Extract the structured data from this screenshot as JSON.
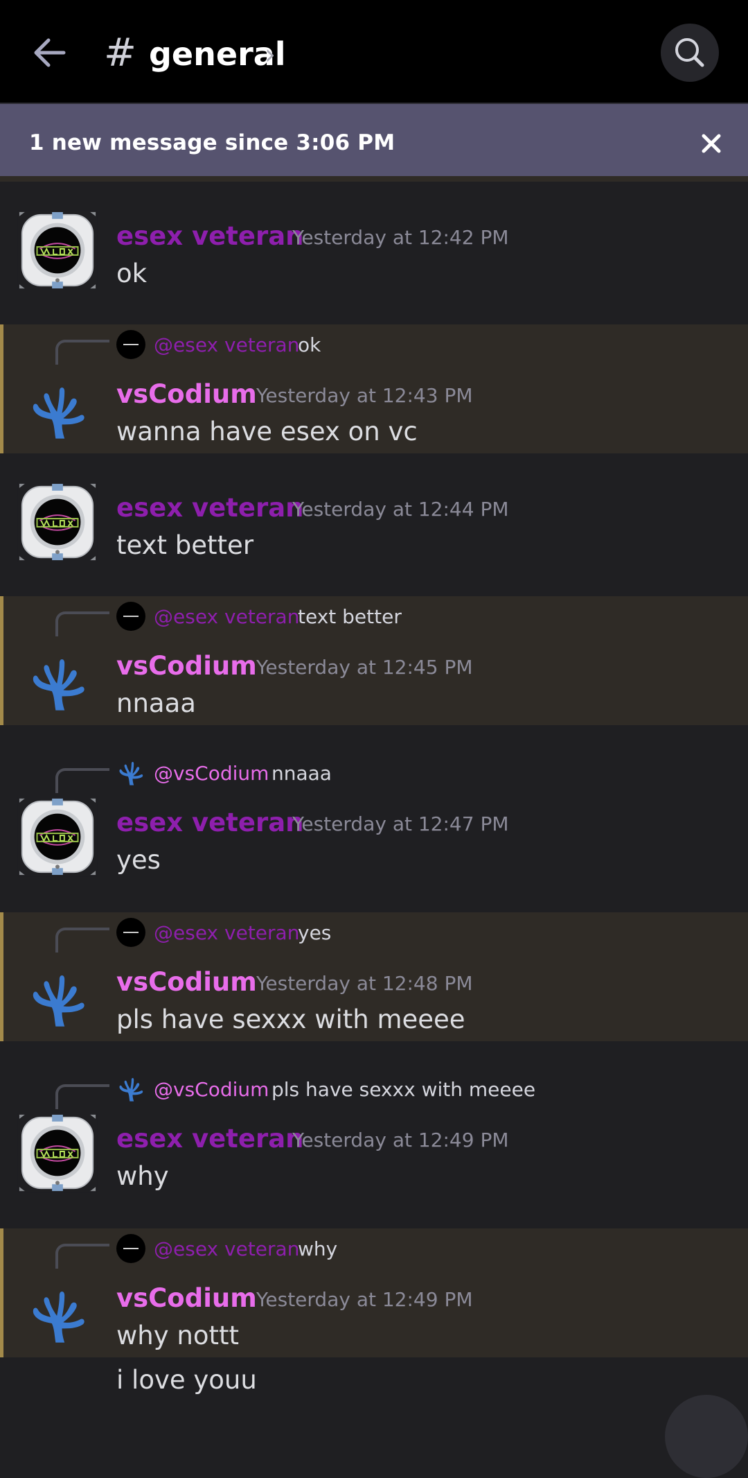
{
  "header": {
    "back_icon": "arrow-left-icon",
    "hash": "#",
    "channel": "general",
    "chevron": "›",
    "search_icon": "search-icon"
  },
  "banner": {
    "text": "1 new message since 3:06 PM",
    "close_icon": "close-icon"
  },
  "messages": [
    {
      "author": "esex veteran",
      "time": "Yesterday at 12:42 PM",
      "content": "ok"
    },
    {
      "reply_to": "@esex veteran",
      "reply_text": "ok",
      "author": "vsCodium",
      "time": "Yesterday at 12:43 PM",
      "content": "wanna have esex on vc"
    },
    {
      "author": "esex veteran",
      "time": "Yesterday at 12:44 PM",
      "content": "text better"
    },
    {
      "reply_to": "@esex veteran",
      "reply_text": "text better",
      "author": "vsCodium",
      "time": "Yesterday at 12:45 PM",
      "content": "nnaaa"
    },
    {
      "reply_to": "@vsCodium",
      "reply_text": "nnaaa",
      "author": "esex veteran",
      "time": "Yesterday at 12:47 PM",
      "content": "yes"
    },
    {
      "reply_to": "@esex veteran",
      "reply_text": "yes",
      "author": "vsCodium",
      "time": "Yesterday at 12:48 PM",
      "content": "pls have sexxx with meeee"
    },
    {
      "reply_to": "@vsCodium",
      "reply_text": "pls have sexxx with meeee",
      "author": "esex veteran",
      "time": "Yesterday at 12:49 PM",
      "content": "why"
    },
    {
      "reply_to": "@esex veteran",
      "reply_text": "why",
      "author": "vsCodium",
      "time": "Yesterday at 12:49 PM",
      "content": "why nottt"
    }
  ],
  "followup": {
    "content": "i love youu"
  },
  "colors": {
    "esex_name": "#8e1fad",
    "vs_name": "#e86dea",
    "mention_bg": "#2f2b26",
    "mention_bar": "#a38a4a",
    "banner_bg": "#56536f",
    "coral_blue": "#3b7bd0"
  },
  "icons": {
    "esex_avatar": "portal-ring-avatar",
    "vs_avatar": "coral-logo-avatar",
    "scroll_button": "jump-to-present-button"
  }
}
